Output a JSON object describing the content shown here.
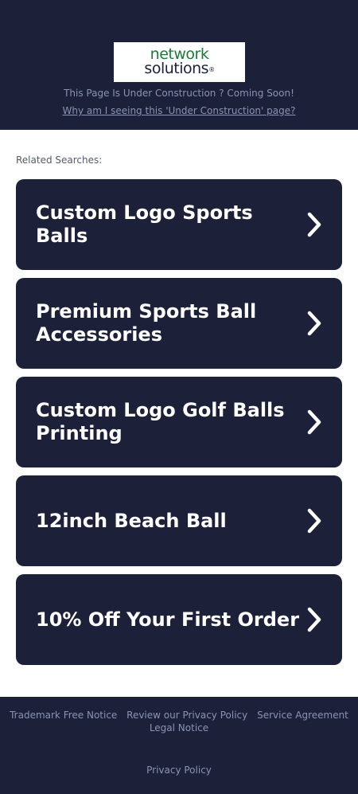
{
  "header": {
    "logo": {
      "line1": "network",
      "line2": "solutions",
      "mark": "®"
    },
    "under_construction_text": "This Page Is Under Construction ? Coming Soon!",
    "why_link": "Why am I seeing this 'Under Construction' page?"
  },
  "related": {
    "label": "Related Searches:",
    "items": [
      {
        "label": "Custom Logo Sports Balls"
      },
      {
        "label": "Premium Sports Ball Accessories"
      },
      {
        "label": "Custom Logo Golf Balls Printing"
      },
      {
        "label": "12inch Beach Ball"
      },
      {
        "label": "10% Off Your First Order"
      }
    ]
  },
  "footer": {
    "links": [
      "Trademark Free Notice",
      "Review our Privacy Policy",
      "Service Agreement",
      "Legal Notice"
    ],
    "privacy": "Privacy Policy"
  },
  "colors": {
    "navy": "#1c2039",
    "muted_text": "#8a93b4",
    "brand_green": "#1e7a3c",
    "white": "#ffffff"
  },
  "icons": {
    "tile_arrow": "chevron-right-icon"
  }
}
